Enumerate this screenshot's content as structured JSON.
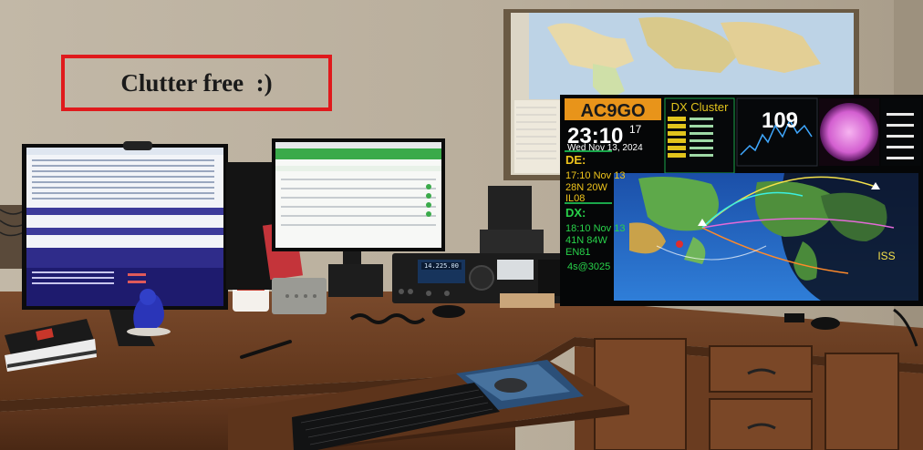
{
  "caption": {
    "text": "Clutter free  :)"
  },
  "dashboard": {
    "callsign": "AC9GO",
    "cluster_title": "DX Cluster",
    "clock_time": "23:10",
    "clock_seconds": "17",
    "clock_date": "Wed Nov 13, 2024",
    "sunspot_number": "109",
    "de_label": "DE:",
    "de_time": "17:10 Nov 13",
    "de_coords": "28N 20W",
    "de_grid": "IL08",
    "dx_label": "DX:",
    "dx_time": "18:10 Nov 13",
    "dx_coords": "41N 84W",
    "dx_grid": "EN81",
    "dx_footer": "4s@3025",
    "map_label": "ISS",
    "colors": {
      "callsign_bg": "#e8941a",
      "panel_bg": "#06080a",
      "ocean": "#1e63c8"
    }
  },
  "radio": {
    "frequency": "14.225.00"
  }
}
